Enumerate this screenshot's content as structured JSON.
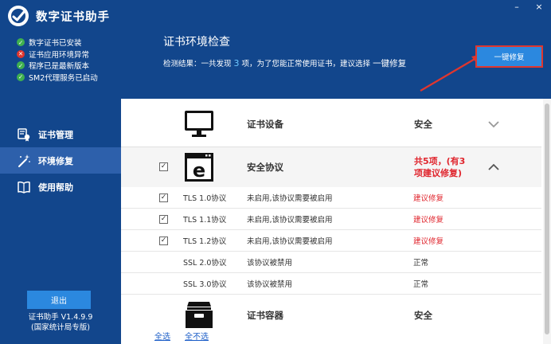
{
  "app": {
    "title": "数字证书助手",
    "version": "证书助手 V1.4.9.9",
    "edition": "(国家统计局专版)"
  },
  "status_items": [
    {
      "label": "数字证书已安装",
      "state": "ok"
    },
    {
      "label": "证书应用环境异常",
      "state": "error"
    },
    {
      "label": "程序已是最新版本",
      "state": "ok"
    },
    {
      "label": "SM2代理服务已启动",
      "state": "ok"
    }
  ],
  "nav": [
    {
      "label": "证书管理",
      "icon": "certificate-icon",
      "active": false
    },
    {
      "label": "环境修复",
      "icon": "wand-icon",
      "active": true
    },
    {
      "label": "使用帮助",
      "icon": "book-icon",
      "active": false
    }
  ],
  "exit_label": "退出",
  "window_controls": {
    "minimize": "–",
    "close": "×"
  },
  "header": {
    "title": "证书环境检查",
    "result_prefix": "检测结果：一共发现 ",
    "result_count": "3",
    "result_mid": " 项，为了您能正常使用证书，建议选择 ",
    "result_action": "一键修复",
    "fix_all_label": "一键修复"
  },
  "categories": {
    "device": {
      "name": "证书设备",
      "status": "安全",
      "icon": "monitor-icon"
    },
    "protocol": {
      "name": "安全协议",
      "status_line1": "共5项，(有3",
      "status_line2": "项建议修复)",
      "icon": "browser-e-icon",
      "checked": true
    },
    "container": {
      "name": "证书容器",
      "status": "安全",
      "icon": "drawer-icon"
    }
  },
  "protocols": [
    {
      "name": "TLS 1.0协议",
      "desc": "未启用,该协议需要被启用",
      "status": "建议修复",
      "checked": true,
      "danger": true
    },
    {
      "name": "TLS 1.1协议",
      "desc": "未启用,该协议需要被启用",
      "status": "建议修复",
      "checked": true,
      "danger": true
    },
    {
      "name": "TLS 1.2协议",
      "desc": "未启用,该协议需要被启用",
      "status": "建议修复",
      "checked": true,
      "danger": true
    },
    {
      "name": "SSL 2.0协议",
      "desc": "该协议被禁用",
      "status": "正常",
      "checked": false,
      "danger": false
    },
    {
      "name": "SSL 3.0协议",
      "desc": "该协议被禁用",
      "status": "正常",
      "checked": false,
      "danger": false
    }
  ],
  "footer": {
    "select_all": "全选",
    "select_none": "全不选"
  },
  "colors": {
    "primary": "#12468c",
    "accent": "#2b88df",
    "danger": "#e0262e",
    "ok": "#3fb04f"
  }
}
